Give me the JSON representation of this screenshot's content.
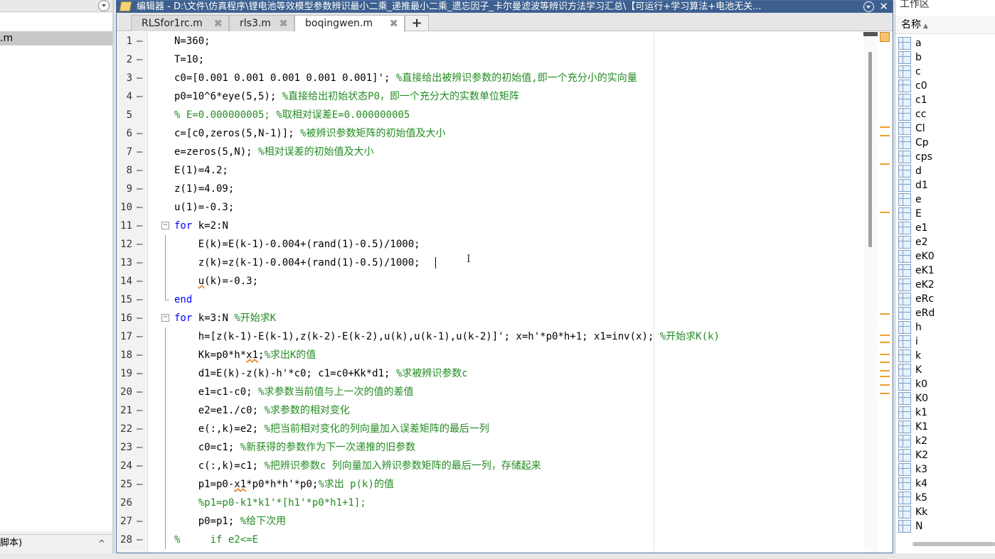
{
  "left_panel": {
    "file_label": ".m",
    "bottom_label": "脚本)",
    "chevron": "^"
  },
  "editor": {
    "title": "编辑器 - D:\\文件\\仿真程序\\锂电池等效模型参数辨识最小二乘_递推最小二乘_遗忘因子_卡尔曼滤波等辨识方法学习汇总\\【可运行+学习算法+电池无关...",
    "close_glyph": "✕",
    "tabs": [
      {
        "label": "RLSfor1rc.m",
        "close": "✖"
      },
      {
        "label": "rls3.m",
        "close": "✖"
      },
      {
        "label": "boqingwen.m",
        "close": "✖"
      }
    ],
    "add_tab": "+",
    "ibeam": "I",
    "lines": [
      {
        "n": "1",
        "d": "—",
        "c": [
          {
            "t": "N=360;",
            "k": "p"
          }
        ]
      },
      {
        "n": "2",
        "d": "—",
        "c": [
          {
            "t": "T=10;",
            "k": "p"
          }
        ]
      },
      {
        "n": "3",
        "d": "—",
        "c": [
          {
            "t": "c0=[0.001 0.001 0.001 0.001 0.001]'; ",
            "k": "p"
          },
          {
            "t": "%直接给出被辨识参数的初始值,即一个充分小的实向量",
            "k": "c"
          }
        ]
      },
      {
        "n": "4",
        "d": "—",
        "c": [
          {
            "t": "p0=10^6*eye(5,5); ",
            "k": "p"
          },
          {
            "t": "%直接给出初始状态P0，即一个充分大的实数单位矩阵",
            "k": "c"
          }
        ]
      },
      {
        "n": "5",
        "d": "",
        "c": [
          {
            "t": "% E=0.000000005; %取相对误差E=0.000000005",
            "k": "c"
          }
        ]
      },
      {
        "n": "6",
        "d": "—",
        "c": [
          {
            "t": "c=[c0,zeros(5,N-1)]; ",
            "k": "p"
          },
          {
            "t": "%被辨识参数矩阵的初始值及大小",
            "k": "c"
          }
        ]
      },
      {
        "n": "7",
        "d": "—",
        "c": [
          {
            "t": "e=zeros(5,N); ",
            "k": "p"
          },
          {
            "t": "%相对误差的初始值及大小",
            "k": "c"
          }
        ]
      },
      {
        "n": "8",
        "d": "—",
        "c": [
          {
            "t": "E(1)=4.2;",
            "k": "p"
          }
        ]
      },
      {
        "n": "9",
        "d": "—",
        "c": [
          {
            "t": "z(1)=4.09;",
            "k": "p"
          }
        ]
      },
      {
        "n": "10",
        "d": "—",
        "c": [
          {
            "t": "u(1)=-0.3;",
            "k": "p"
          }
        ]
      },
      {
        "n": "11",
        "d": "—",
        "f": "open",
        "c": [
          {
            "t": "for",
            "k": "k"
          },
          {
            "t": " k=2:N",
            "k": "p"
          }
        ]
      },
      {
        "n": "12",
        "d": "—",
        "f": "line",
        "c": [
          {
            "t": "    E(k)=E(k-1)-0.004+(rand(1)-0.5)/1000;",
            "k": "p"
          }
        ]
      },
      {
        "n": "13",
        "d": "—",
        "f": "line",
        "cursor": true,
        "c": [
          {
            "t": "    z(k)=z(k-1)-0.004+(rand(1)-0.5)/1000;",
            "k": "p"
          }
        ]
      },
      {
        "n": "14",
        "d": "—",
        "f": "line",
        "c": [
          {
            "t": "    ",
            "k": "p"
          },
          {
            "t": "u",
            "k": "s"
          },
          {
            "t": "(k)=-0.3;",
            "k": "p"
          }
        ]
      },
      {
        "n": "15",
        "d": "—",
        "f": "end",
        "c": [
          {
            "t": "end",
            "k": "k"
          }
        ]
      },
      {
        "n": "16",
        "d": "—",
        "f": "open",
        "c": [
          {
            "t": "for",
            "k": "k"
          },
          {
            "t": " k=3:N ",
            "k": "p"
          },
          {
            "t": "%开始求K",
            "k": "c"
          }
        ]
      },
      {
        "n": "17",
        "d": "—",
        "f": "line",
        "c": [
          {
            "t": "    h=[z(k-1)-E(k-1),z(k-2)-E(k-2),u(k),u(k-1),u(k-2)]'; x=h'*p0*h+1; x1=inv(x); ",
            "k": "p"
          },
          {
            "t": "%开始求K(k)",
            "k": "c"
          }
        ]
      },
      {
        "n": "18",
        "d": "—",
        "f": "line",
        "c": [
          {
            "t": "    Kk=p0*h*",
            "k": "p"
          },
          {
            "t": "x1",
            "k": "s"
          },
          {
            "t": ";",
            "k": "p"
          },
          {
            "t": "%求出K的值",
            "k": "c"
          }
        ]
      },
      {
        "n": "19",
        "d": "—",
        "f": "line",
        "c": [
          {
            "t": "    d1=E(k)-z(k)-h'*c0; c1=c0+Kk*d1; ",
            "k": "p"
          },
          {
            "t": "%求被辨识参数c",
            "k": "c"
          }
        ]
      },
      {
        "n": "20",
        "d": "—",
        "f": "line",
        "c": [
          {
            "t": "    e1=c1-c0; ",
            "k": "p"
          },
          {
            "t": "%求参数当前值与上一次的值的差值",
            "k": "c"
          }
        ]
      },
      {
        "n": "21",
        "d": "—",
        "f": "line",
        "c": [
          {
            "t": "    e2=e1./c0; ",
            "k": "p"
          },
          {
            "t": "%求参数的相对变化",
            "k": "c"
          }
        ]
      },
      {
        "n": "22",
        "d": "—",
        "f": "line",
        "c": [
          {
            "t": "    e(:,k)=e2; ",
            "k": "p"
          },
          {
            "t": "%把当前相对变化的列向量加入误差矩阵的最后一列",
            "k": "c"
          }
        ]
      },
      {
        "n": "23",
        "d": "—",
        "f": "line",
        "c": [
          {
            "t": "    c0=c1; ",
            "k": "p"
          },
          {
            "t": "%新获得的参数作为下一次递推的旧参数",
            "k": "c"
          }
        ]
      },
      {
        "n": "24",
        "d": "—",
        "f": "line",
        "c": [
          {
            "t": "    c(:,k)=c1; ",
            "k": "p"
          },
          {
            "t": "%把辨识参数c 列向量加入辨识参数矩阵的最后一列，存储起来",
            "k": "c"
          }
        ]
      },
      {
        "n": "25",
        "d": "—",
        "f": "line",
        "c": [
          {
            "t": "    p1=p0-",
            "k": "p"
          },
          {
            "t": "x1",
            "k": "s"
          },
          {
            "t": "*p0*h*h'*p0;",
            "k": "p"
          },
          {
            "t": "%求出 p(k)的值",
            "k": "c"
          }
        ]
      },
      {
        "n": "26",
        "d": "",
        "f": "line",
        "c": [
          {
            "t": "    %p1=p0-k1*k1'*[h1'*p0*h1+1];",
            "k": "c"
          }
        ]
      },
      {
        "n": "27",
        "d": "—",
        "f": "line",
        "c": [
          {
            "t": "    p0=p1; ",
            "k": "p"
          },
          {
            "t": "%给下次用",
            "k": "c"
          }
        ]
      },
      {
        "n": "28",
        "d": "—",
        "f": "line",
        "c": [
          {
            "t": "%     if e2<=E",
            "k": "c"
          }
        ]
      }
    ]
  },
  "workspace": {
    "title": "工作区",
    "column_header": "名称",
    "sort_glyph": "▲",
    "variables": [
      "a",
      "b",
      "c",
      "c0",
      "c1",
      "cc",
      "Cl",
      "Cp",
      "cps",
      "d",
      "d1",
      "e",
      "E",
      "e1",
      "e2",
      "eK0",
      "eK1",
      "eK2",
      "eRc",
      "eRd",
      "h",
      "i",
      "k",
      "K",
      "k0",
      "K0",
      "k1",
      "K1",
      "k2",
      "K2",
      "k3",
      "k4",
      "k5",
      "Kk",
      "N"
    ]
  },
  "colors": {
    "keyword": "#0000ff",
    "comment": "#228b22",
    "title_bar": "#3c5f8f",
    "marker": "#f0a030"
  }
}
